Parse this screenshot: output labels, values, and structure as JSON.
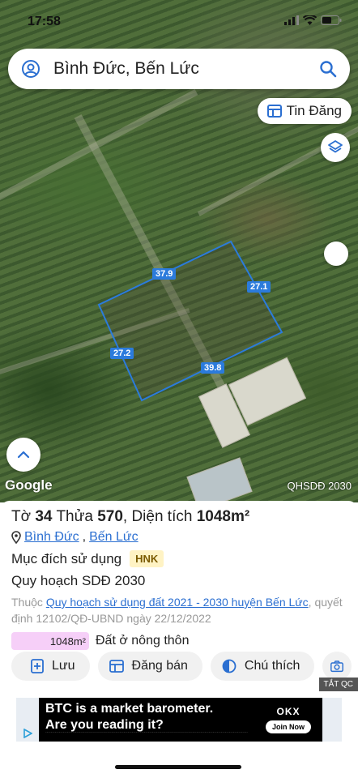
{
  "status_bar": {
    "time": "17:58"
  },
  "search": {
    "query": "Bình Đức, Bến Lức"
  },
  "map": {
    "tin_dang_label": "Tin Đăng",
    "edge_labels": [
      "37.9",
      "27.1",
      "27.2",
      "39.8"
    ],
    "google_label": "Google",
    "layer_label": "QHSDĐ 2030",
    "plot_color": "#2b7bdc"
  },
  "parcel": {
    "title_prefix": "Tờ",
    "sheet": "34",
    "plot_label": "Thửa",
    "plot": "570",
    "area_label": ", Diện tích",
    "area": "1048m²",
    "location_commune": "Bình Đức",
    "location_sep": ",",
    "location_district": "Bến Lức",
    "purpose_label": "Mục đích sử dụng",
    "purpose_code": "HNK",
    "plan_title": "Quy hoạch SDĐ 2030",
    "plan_desc_prefix": "Thuộc",
    "plan_link": "Quy hoạch sử dụng đất 2021 - 2030 huyện Bến Lức",
    "plan_desc_suffix": ", quyết định 12102/QĐ-UBND ngày 22/12/2022",
    "zone_area": "1048m²",
    "zone_label": "Đất ở nông thôn",
    "zone_color": "#f6cff8"
  },
  "actions": {
    "save": "Lưu",
    "post": "Đăng bán",
    "legend": "Chú thích"
  },
  "ad": {
    "close_label": "TẮT QC",
    "line1": "BTC is a market barometer.",
    "line2": "Are you reading it?",
    "brand": "OKX",
    "cta": "Join Now"
  }
}
